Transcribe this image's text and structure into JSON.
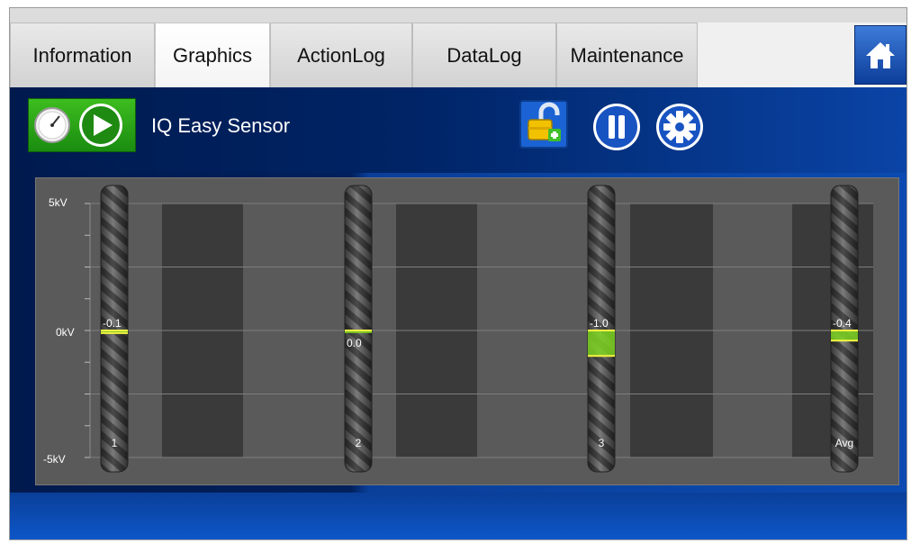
{
  "tabs": [
    {
      "label": "Information",
      "active": false
    },
    {
      "label": "Graphics",
      "active": true
    },
    {
      "label": "ActionLog",
      "active": false
    },
    {
      "label": "DataLog",
      "active": false
    },
    {
      "label": "Maintenance",
      "active": false
    }
  ],
  "icons": {
    "home": "home-icon",
    "status": "gauge-play-icon",
    "lock": "unlocked-padlock-icon",
    "pause": "pause-icon",
    "settings": "gear-icon"
  },
  "header": {
    "title": "IQ Easy Sensor"
  },
  "colors": {
    "accent_blue": "#0b4ab0",
    "indicator_green": "#7ed321",
    "indicator_line": "#f5f542",
    "status_green": "#2fae18"
  },
  "chart_data": {
    "type": "bar",
    "y_axis": {
      "tick_labels": [
        "5kV",
        "0kV",
        "-5kV"
      ],
      "range": [
        -5,
        5
      ],
      "unit": "kV"
    },
    "bars": [
      {
        "label": "1",
        "value": -0.1,
        "value_label": "-0.1"
      },
      {
        "label": "2",
        "value": 0.0,
        "value_label": "0.0"
      },
      {
        "label": "3",
        "value": -1.0,
        "value_label": "-1.0"
      },
      {
        "label": "Avg",
        "value": -0.4,
        "value_label": "-0.4"
      }
    ],
    "grid": true
  }
}
